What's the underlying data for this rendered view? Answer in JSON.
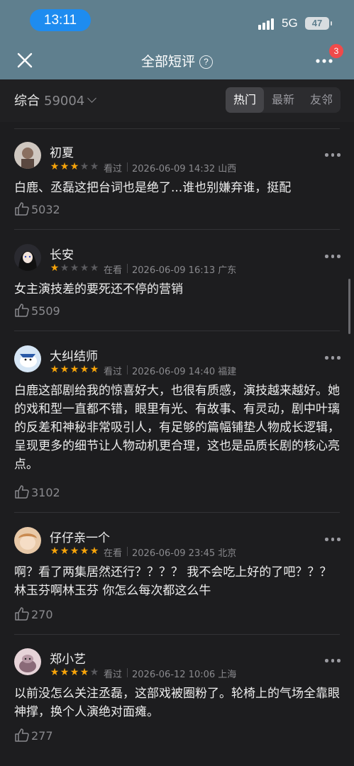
{
  "status_bar": {
    "time": "13:11",
    "network": "5G",
    "battery": "47"
  },
  "nav": {
    "title": "全部短评",
    "help_icon": "help-circle-icon",
    "badge": "3"
  },
  "filter": {
    "sort_label": "综合",
    "count": "59004",
    "tabs": [
      "热门",
      "最新",
      "友邻"
    ],
    "active_tab": "热门"
  },
  "colors": {
    "star_on": "#f5a30a",
    "star_off": "#5a5a5e",
    "badge": "#f04a4a",
    "accent_time": "#1e8cf0"
  },
  "reviews": [
    {
      "name": "初夏",
      "rating": 3,
      "status": "看过",
      "meta": "2026-06-09 14:32 山西",
      "text": "白鹿、丞磊这把台词也是绝了...谁也别嫌弃谁，挺配",
      "likes": "5032"
    },
    {
      "name": "长安",
      "rating": 1,
      "status": "在看",
      "meta": "2026-06-09 16:13 广东",
      "text": "女主演技差的要死还不停的营销",
      "likes": "5509"
    },
    {
      "name": "大纠结师",
      "rating": 5,
      "status": "看过",
      "meta": "2026-06-09 14:40 福建",
      "text": "白鹿这部剧给我的惊喜好大，也很有质感，演技越来越好。她的戏和型一直都不错，眼里有光、有故事、有灵动，剧中叶璃的反差和神秘非常吸引人，有足够的篇幅铺垫人物成长逻辑，呈现更多的细节让人物动机更合理，这也是品质长剧的核心亮点。",
      "likes": "3102"
    },
    {
      "name": "仔仔亲一个",
      "rating": 5,
      "status": "在看",
      "meta": "2026-06-09 23:45 北京",
      "text": "啊？看了两集居然还行？？？？ 我不会吃上好的了吧？？？ 林玉芬啊林玉芬 你怎么每次都这么牛",
      "likes": "270"
    },
    {
      "name": "郑小艺",
      "rating": 4,
      "status": "看过",
      "meta": "2026-06-12 10:06 上海",
      "text": "以前没怎么关注丞磊，这部戏被圈粉了。轮椅上的气场全靠眼神撑，换个人演绝对面瘫。",
      "likes": "277"
    }
  ]
}
